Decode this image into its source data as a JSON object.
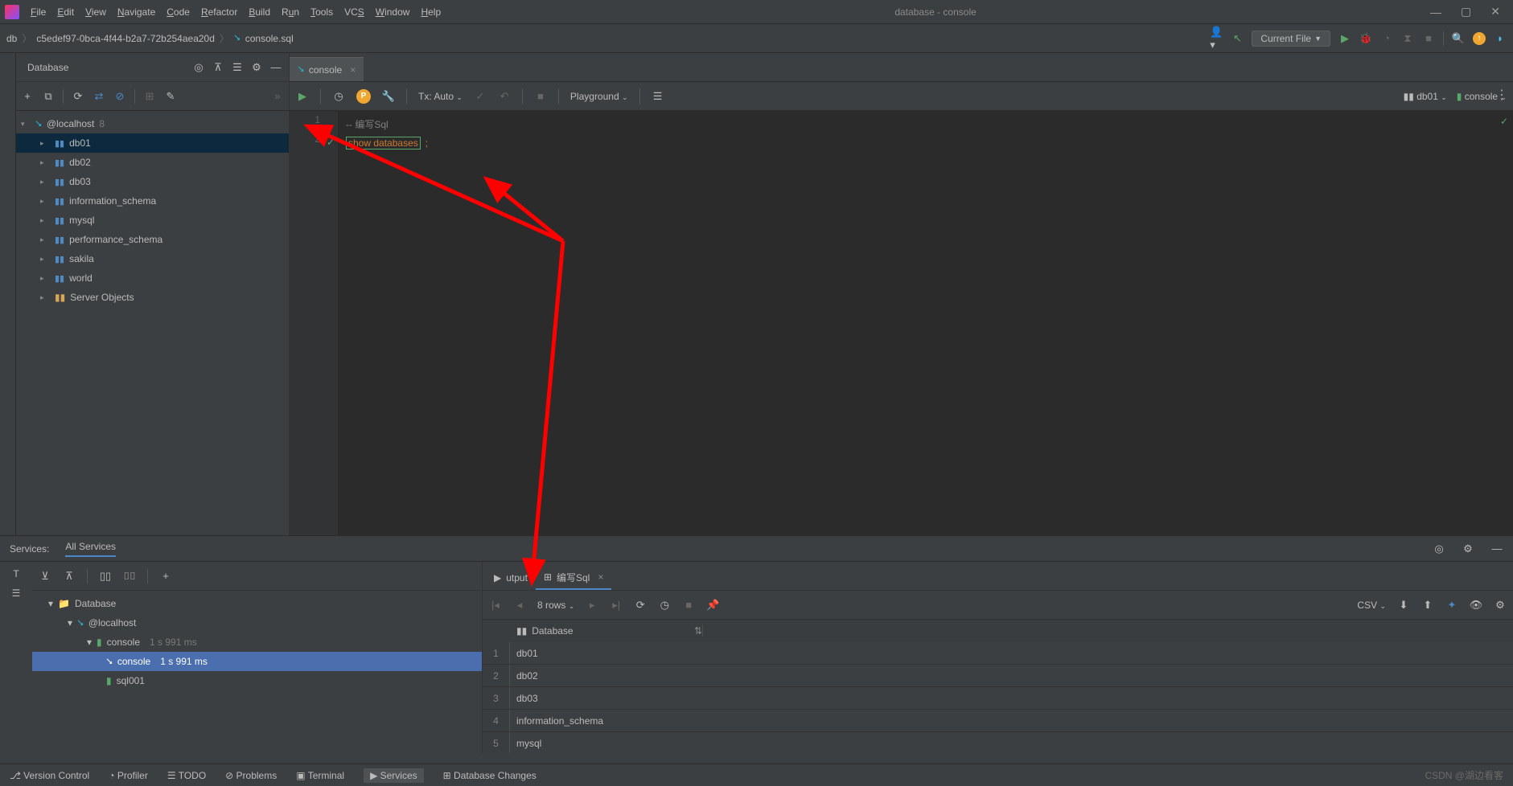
{
  "menu": {
    "file": "File",
    "edit": "Edit",
    "view": "View",
    "navigate": "Navigate",
    "code": "Code",
    "refactor": "Refactor",
    "build": "Build",
    "run": "Run",
    "tools": "Tools",
    "vcs": "VCS",
    "window": "Window",
    "help": "Help"
  },
  "title": "database - console",
  "breadcrumb": {
    "db": "db",
    "guid": "c5edef97-0bca-4f44-b2a7-72b254aea20d",
    "file": "console.sql"
  },
  "runconfig": "Current File",
  "sidebar": {
    "title": "Database",
    "root": "@localhost",
    "rootcount": "8",
    "items": [
      "db01",
      "db02",
      "db03",
      "information_schema",
      "mysql",
      "performance_schema",
      "sakila",
      "world"
    ],
    "server": "Server Objects"
  },
  "tab": "console",
  "edtoolbar": {
    "tx": "Tx: Auto",
    "mode": "Playground",
    "ds": "db01",
    "con": "console"
  },
  "code": {
    "l1": "-- 编写Sql",
    "l2a": "show",
    "l2b": "databases",
    "l2c": ";"
  },
  "services": {
    "label": "Services:",
    "all": "All Services",
    "tree": {
      "db": "Database",
      "host": "@localhost",
      "con": "console",
      "con_ms": "1 s 991 ms",
      "con2": "console",
      "con2_ms": "1 s 991 ms",
      "sql": "sql001"
    },
    "tabs": {
      "output": "utput",
      "tab2": "编写Sql"
    },
    "rows": "8 rows",
    "fmt": "CSV",
    "col": "Database",
    "data": [
      "db01",
      "db02",
      "db03",
      "information_schema",
      "mysql"
    ]
  },
  "status": {
    "vc": "Version Control",
    "prof": "Profiler",
    "todo": "TODO",
    "prob": "Problems",
    "term": "Terminal",
    "svc": "Services",
    "dbch": "Database Changes",
    "wm": "CSDN @湖边看客"
  }
}
